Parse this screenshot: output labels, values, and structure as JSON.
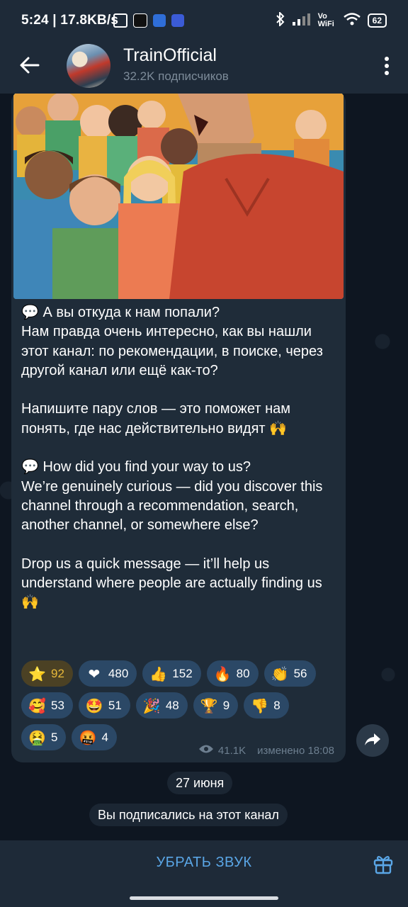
{
  "status_bar": {
    "time_speed": "5:24 | 17.8KB/s",
    "vowifi": "Vo WiFi",
    "battery": "62"
  },
  "header": {
    "title": "TrainOfficial",
    "subtitle": "32.2K подписчиков"
  },
  "message": {
    "text": "💬 А вы откуда к нам попали?\nНам правда очень интересно, как вы нашли этот канал: по рекомендации, в поиске, через другой канал или ещё как-то?\n\nНапишите пару слов — это поможет нам понять, где нас действительно видят 🙌\n\n💬 How did you find your way to us?\nWe’re genuinely curious — did you discover this channel through a recommendation, search, another channel, or somewhere else?\n\nDrop us a quick message — it’ll help us understand where people are actually finding us 🙌",
    "views": "41.1K",
    "edited_time": "изменено 18:08",
    "reactions": [
      [
        {
          "emoji": "⭐",
          "count": "92",
          "active": true
        },
        {
          "emoji": "❤",
          "count": "480"
        },
        {
          "emoji": "👍",
          "count": "152"
        },
        {
          "emoji": "🔥",
          "count": "80"
        },
        {
          "emoji": "👏",
          "count": "56"
        }
      ],
      [
        {
          "emoji": "🥰",
          "count": "53"
        },
        {
          "emoji": "🤩",
          "count": "51"
        },
        {
          "emoji": "🎉",
          "count": "48"
        },
        {
          "emoji": "🏆",
          "count": "9"
        },
        {
          "emoji": "👎",
          "count": "8"
        }
      ],
      [
        {
          "emoji": "🤮",
          "count": "5"
        },
        {
          "emoji": "🤬",
          "count": "4"
        }
      ]
    ]
  },
  "service": {
    "date": "27 июня",
    "subscribed": "Вы подписались на этот канал"
  },
  "bottom": {
    "mute_label": "УБРАТЬ ЗВУК"
  },
  "colors": {
    "background": "#0e1621",
    "bar": "#1e2a38",
    "bubble": "#1f2c39",
    "accent": "#5aa6e6",
    "star_reaction": "#e8b93a"
  }
}
